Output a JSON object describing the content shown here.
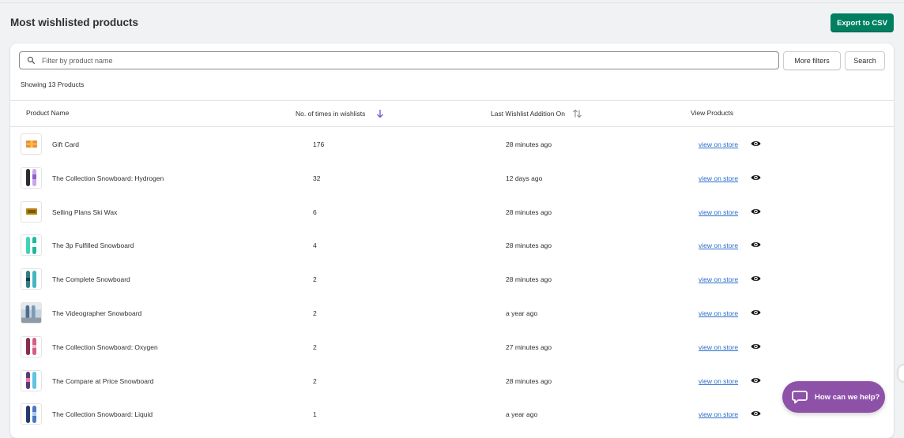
{
  "header": {
    "title": "Most wishlisted products",
    "export_label": "Export to CSV"
  },
  "filters": {
    "search_placeholder": "Filter by product name",
    "more_filters_label": "More filters",
    "search_label": "Search",
    "showing_text": "Showing 13 Products"
  },
  "table": {
    "columns": [
      "Product Name",
      "No. of times in wishlists",
      "Last Wishlist Addition On",
      "View Products"
    ],
    "rows": [
      {
        "name": "Gift Card",
        "count": "176",
        "last": "28 minutes ago",
        "link": "view on store"
      },
      {
        "name": "The Collection Snowboard: Hydrogen",
        "count": "32",
        "last": "12 days ago",
        "link": "view on store"
      },
      {
        "name": "Selling Plans Ski Wax",
        "count": "6",
        "last": "28 minutes ago",
        "link": "view on store"
      },
      {
        "name": "The 3p Fulfilled Snowboard",
        "count": "4",
        "last": "28 minutes ago",
        "link": "view on store"
      },
      {
        "name": "The Complete Snowboard",
        "count": "2",
        "last": "28 minutes ago",
        "link": "view on store"
      },
      {
        "name": "The Videographer Snowboard",
        "count": "2",
        "last": "a year ago",
        "link": "view on store"
      },
      {
        "name": "The Collection Snowboard: Oxygen",
        "count": "2",
        "last": "27 minutes ago",
        "link": "view on store"
      },
      {
        "name": "The Compare at Price Snowboard",
        "count": "2",
        "last": "28 minutes ago",
        "link": "view on store"
      },
      {
        "name": "The Collection Snowboard: Liquid",
        "count": "1",
        "last": "a year ago",
        "link": "view on store"
      }
    ]
  },
  "help": {
    "label": "How can we help?"
  },
  "colors": {
    "primary_button": "#008060",
    "link": "#2c6ecb",
    "sort_active": "#6c4fd8",
    "help_widget": "#8e51a8"
  }
}
